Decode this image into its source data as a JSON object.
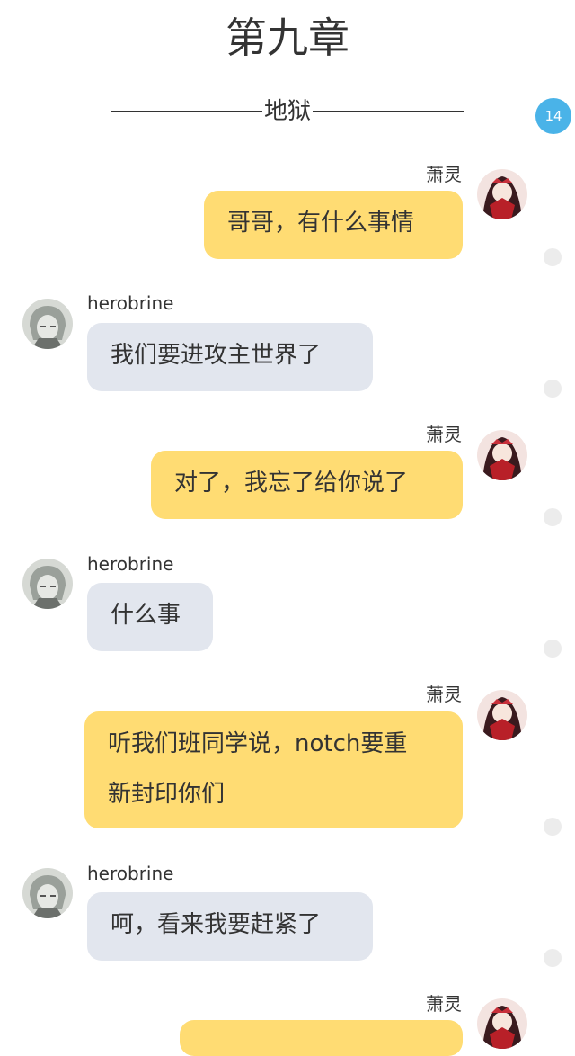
{
  "header": {
    "chapter_title": "第九章",
    "subtitle": "地狱",
    "badge_count": "14"
  },
  "messages": [
    {
      "sender": "萧灵",
      "side": "right",
      "text": "哥哥，有什么事情"
    },
    {
      "sender": "herobrine",
      "side": "left",
      "text": "我们要进攻主世界了"
    },
    {
      "sender": "萧灵",
      "side": "right",
      "text": "对了，我忘了给你说了"
    },
    {
      "sender": "herobrine",
      "side": "left",
      "text": "什么事"
    },
    {
      "sender": "萧灵",
      "side": "right",
      "lines": [
        "听我们班同学说，notch要重",
        "新封印你们"
      ]
    },
    {
      "sender": "herobrine",
      "side": "left",
      "text": "呵，看来我要赶紧了"
    },
    {
      "sender": "萧灵",
      "side": "right",
      "text": ""
    }
  ],
  "colors": {
    "right_bubble": "#ffdc73",
    "left_bubble": "#e2e6ee",
    "badge": "#4ab3e8"
  },
  "icons": {
    "right_avatar": "anime-girl-avatar-icon",
    "left_avatar": "herobrine-avatar-icon"
  }
}
